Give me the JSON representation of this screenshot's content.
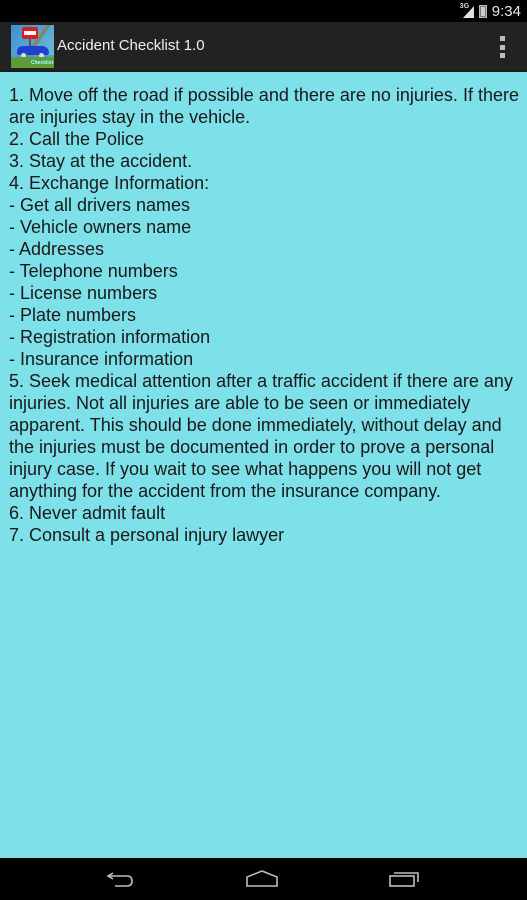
{
  "status_bar": {
    "network": "3G",
    "time": "9:34",
    "icons": [
      "signal-3g-icon",
      "battery-charging-icon"
    ]
  },
  "action_bar": {
    "app_icon": "accident-checklist-app-icon",
    "app_icon_label": "Checklist",
    "title": "Accident Checklist 1.0",
    "overflow_icon": "overflow-menu-icon"
  },
  "content": {
    "background_color": "#7ee0e8",
    "lines": [
      "1. Move off the road if possible and there are no injuries. If there are injuries stay in the vehicle.",
      "2. Call the Police",
      "3. Stay at the accident.",
      "4. Exchange Information:",
      "- Get all drivers names",
      "- Vehicle owners name",
      "- Addresses",
      "- Telephone numbers",
      "- License numbers",
      "- Plate numbers",
      "- Registration information",
      "- Insurance information",
      "5. Seek medical attention after a traffic accident if there are any injuries. Not all injuries are able to be seen or immediately apparent. This should be done immediately, without delay and the injuries must be documented in order to prove a personal injury case. If you wait to see what happens you will not get anything for the accident from the insurance company.",
      "6. Never admit fault",
      "7. Consult a personal injury lawyer"
    ]
  },
  "nav_bar": {
    "buttons": [
      {
        "name": "back",
        "icon": "back-icon"
      },
      {
        "name": "home",
        "icon": "home-icon"
      },
      {
        "name": "recent-apps",
        "icon": "recent-apps-icon"
      }
    ]
  }
}
